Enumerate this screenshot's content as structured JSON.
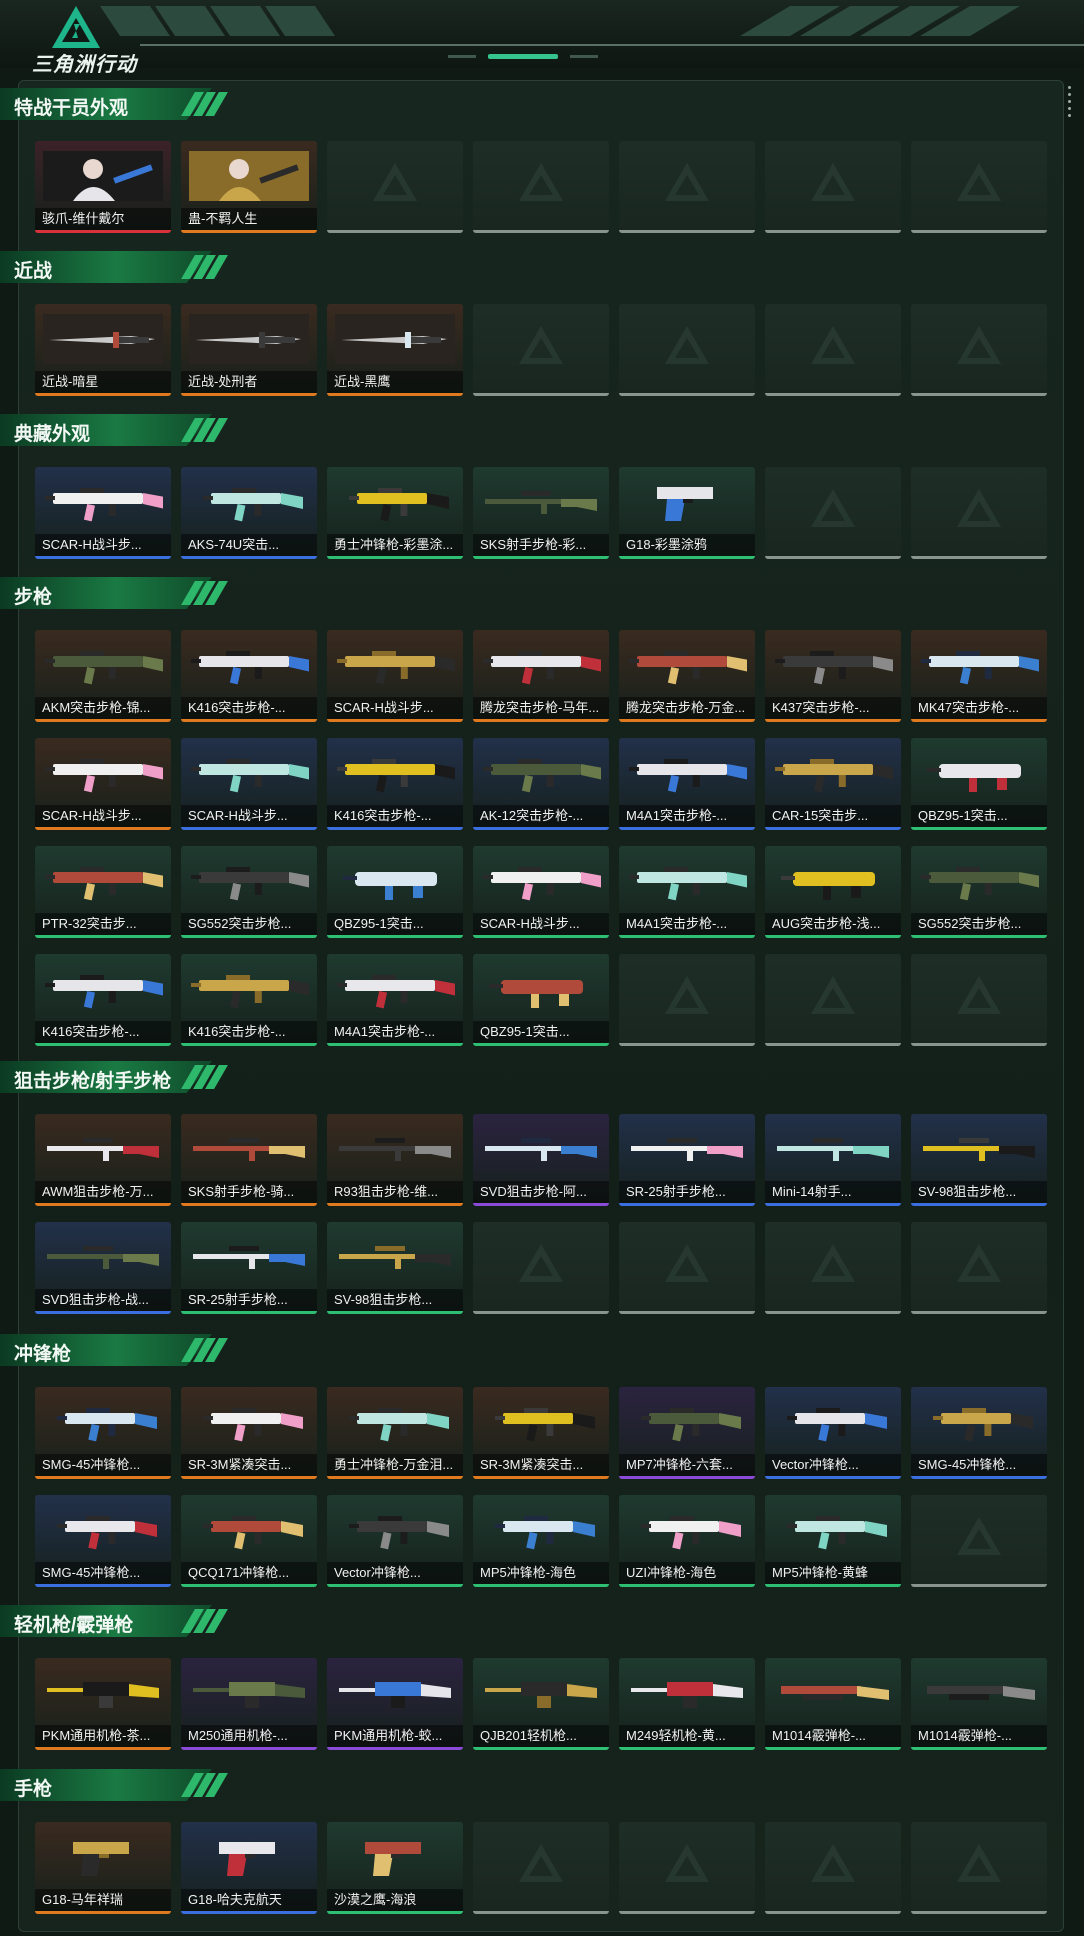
{
  "app": {
    "logo_text": "三角洲行动",
    "accent": "#35c48d"
  },
  "rarity_colors": {
    "red": "#d8333a",
    "orange": "#e07a1e",
    "purple": "#8a4bd8",
    "blue": "#3b6fe0",
    "green": "#2fbf73",
    "gray": "#8a948f"
  },
  "sections": [
    {
      "title": "特战干员外观",
      "tiles": [
        {
          "name": "骇爪-维什戴尔",
          "rarity": "red",
          "kind": "operator"
        },
        {
          "name": "蛊-不羁人生",
          "rarity": "orange",
          "kind": "operator"
        },
        {
          "empty": true
        },
        {
          "empty": true
        },
        {
          "empty": true
        },
        {
          "empty": true
        },
        {
          "empty": true
        }
      ]
    },
    {
      "title": "近战",
      "tiles": [
        {
          "name": "近战-暗星",
          "rarity": "orange",
          "kind": "melee"
        },
        {
          "name": "近战-处刑者",
          "rarity": "orange",
          "kind": "melee"
        },
        {
          "name": "近战-黑鹰",
          "rarity": "orange",
          "kind": "melee"
        },
        {
          "empty": true
        },
        {
          "empty": true
        },
        {
          "empty": true
        },
        {
          "empty": true
        }
      ]
    },
    {
      "title": "典藏外观",
      "tiles": [
        {
          "name": "SCAR-H战斗步...",
          "rarity": "blue",
          "kind": "rifle"
        },
        {
          "name": "AKS-74U突击...",
          "rarity": "blue",
          "kind": "smg"
        },
        {
          "name": "勇士冲锋枪-彩墨涂...",
          "rarity": "green",
          "kind": "smg"
        },
        {
          "name": "SKS射手步枪-彩...",
          "rarity": "green",
          "kind": "sniper"
        },
        {
          "name": "G18-彩墨涂鸦",
          "rarity": "green",
          "kind": "pistol"
        },
        {
          "empty": true
        },
        {
          "empty": true
        }
      ]
    },
    {
      "title": "步枪",
      "tiles": [
        {
          "name": "AKM突击步枪-锦...",
          "rarity": "orange",
          "kind": "rifle"
        },
        {
          "name": "K416突击步枪-...",
          "rarity": "orange",
          "kind": "rifle"
        },
        {
          "name": "SCAR-H战斗步...",
          "rarity": "orange",
          "kind": "rifle"
        },
        {
          "name": "腾龙突击步枪-马年...",
          "rarity": "orange",
          "kind": "rifle"
        },
        {
          "name": "腾龙突击步枪-万金...",
          "rarity": "orange",
          "kind": "rifle"
        },
        {
          "name": "K437突击步枪-...",
          "rarity": "orange",
          "kind": "rifle"
        },
        {
          "name": "MK47突击步枪-...",
          "rarity": "orange",
          "kind": "rifle"
        },
        {
          "name": "SCAR-H战斗步...",
          "rarity": "orange",
          "kind": "rifle"
        },
        {
          "name": "SCAR-H战斗步...",
          "rarity": "blue",
          "kind": "rifle"
        },
        {
          "name": "K416突击步枪-...",
          "rarity": "blue",
          "kind": "rifle"
        },
        {
          "name": "AK-12突击步枪-...",
          "rarity": "blue",
          "kind": "rifle"
        },
        {
          "name": "M4A1突击步枪-...",
          "rarity": "blue",
          "kind": "rifle"
        },
        {
          "name": "CAR-15突击步...",
          "rarity": "blue",
          "kind": "rifle"
        },
        {
          "name": "QBZ95-1突击...",
          "rarity": "green",
          "kind": "bullpup"
        },
        {
          "name": "PTR-32突击步...",
          "rarity": "green",
          "kind": "rifle"
        },
        {
          "name": "SG552突击步枪...",
          "rarity": "green",
          "kind": "rifle"
        },
        {
          "name": "QBZ95-1突击...",
          "rarity": "green",
          "kind": "bullpup"
        },
        {
          "name": "SCAR-H战斗步...",
          "rarity": "green",
          "kind": "rifle"
        },
        {
          "name": "M4A1突击步枪-...",
          "rarity": "green",
          "kind": "rifle"
        },
        {
          "name": "AUG突击步枪-浅...",
          "rarity": "green",
          "kind": "bullpup"
        },
        {
          "name": "SG552突击步枪...",
          "rarity": "green",
          "kind": "rifle"
        },
        {
          "name": "K416突击步枪-...",
          "rarity": "green",
          "kind": "rifle"
        },
        {
          "name": "K416突击步枪-...",
          "rarity": "green",
          "kind": "rifle"
        },
        {
          "name": "M4A1突击步枪-...",
          "rarity": "green",
          "kind": "rifle"
        },
        {
          "name": "QBZ95-1突击...",
          "rarity": "green",
          "kind": "bullpup"
        },
        {
          "empty": true
        },
        {
          "empty": true
        },
        {
          "empty": true
        }
      ]
    },
    {
      "title": "狙击步枪/射手步枪",
      "tiles": [
        {
          "name": "AWM狙击步枪-万...",
          "rarity": "orange",
          "kind": "sniper"
        },
        {
          "name": "SKS射手步枪-骑...",
          "rarity": "orange",
          "kind": "sniper"
        },
        {
          "name": "R93狙击步枪-维...",
          "rarity": "orange",
          "kind": "sniper"
        },
        {
          "name": "SVD狙击步枪-阿...",
          "rarity": "purple",
          "kind": "sniper"
        },
        {
          "name": "SR-25射手步枪...",
          "rarity": "blue",
          "kind": "sniper"
        },
        {
          "name": "Mini-14射手...",
          "rarity": "blue",
          "kind": "sniper"
        },
        {
          "name": "SV-98狙击步枪...",
          "rarity": "blue",
          "kind": "sniper"
        },
        {
          "name": "SVD狙击步枪-战...",
          "rarity": "blue",
          "kind": "sniper"
        },
        {
          "name": "SR-25射手步枪...",
          "rarity": "green",
          "kind": "sniper"
        },
        {
          "name": "SV-98狙击步枪...",
          "rarity": "green",
          "kind": "sniper"
        },
        {
          "empty": true
        },
        {
          "empty": true
        },
        {
          "empty": true
        },
        {
          "empty": true
        }
      ]
    },
    {
      "title": "冲锋枪",
      "tiles": [
        {
          "name": "SMG-45冲锋枪...",
          "rarity": "orange",
          "kind": "smg"
        },
        {
          "name": "SR-3M紧凑突击...",
          "rarity": "orange",
          "kind": "smg"
        },
        {
          "name": "勇士冲锋枪-万金泪...",
          "rarity": "orange",
          "kind": "smg"
        },
        {
          "name": "SR-3M紧凑突击...",
          "rarity": "orange",
          "kind": "smg"
        },
        {
          "name": "MP7冲锋枪-六套...",
          "rarity": "purple",
          "kind": "smg"
        },
        {
          "name": "Vector冲锋枪...",
          "rarity": "blue",
          "kind": "smg"
        },
        {
          "name": "SMG-45冲锋枪...",
          "rarity": "blue",
          "kind": "smg"
        },
        {
          "name": "SMG-45冲锋枪...",
          "rarity": "blue",
          "kind": "smg"
        },
        {
          "name": "QCQ171冲锋枪...",
          "rarity": "green",
          "kind": "smg"
        },
        {
          "name": "Vector冲锋枪...",
          "rarity": "green",
          "kind": "smg"
        },
        {
          "name": "MP5冲锋枪-海色",
          "rarity": "green",
          "kind": "smg"
        },
        {
          "name": "UZI冲锋枪-海色",
          "rarity": "green",
          "kind": "smg"
        },
        {
          "name": "MP5冲锋枪-黄蜂",
          "rarity": "green",
          "kind": "smg"
        },
        {
          "empty": true
        }
      ]
    },
    {
      "title": "轻机枪/霰弹枪",
      "tiles": [
        {
          "name": "PKM通用机枪-茶...",
          "rarity": "orange",
          "kind": "lmg"
        },
        {
          "name": "M250通用机枪-...",
          "rarity": "purple",
          "kind": "lmg"
        },
        {
          "name": "PKM通用机枪-蛟...",
          "rarity": "purple",
          "kind": "lmg"
        },
        {
          "name": "QJB201轻机枪...",
          "rarity": "green",
          "kind": "lmg"
        },
        {
          "name": "M249轻机枪-黄...",
          "rarity": "green",
          "kind": "lmg"
        },
        {
          "name": "M1014霰弹枪-...",
          "rarity": "green",
          "kind": "shotgun"
        },
        {
          "name": "M1014霰弹枪-...",
          "rarity": "green",
          "kind": "shotgun"
        }
      ]
    },
    {
      "title": "手枪",
      "tiles": [
        {
          "name": "G18-马年祥瑞",
          "rarity": "orange",
          "kind": "pistol"
        },
        {
          "name": "G18-哈夫克航天",
          "rarity": "blue",
          "kind": "pistol"
        },
        {
          "name": "沙漠之鹰-海浪",
          "rarity": "green",
          "kind": "pistol"
        },
        {
          "empty": true
        },
        {
          "empty": true
        },
        {
          "empty": true
        },
        {
          "empty": true
        }
      ]
    }
  ]
}
